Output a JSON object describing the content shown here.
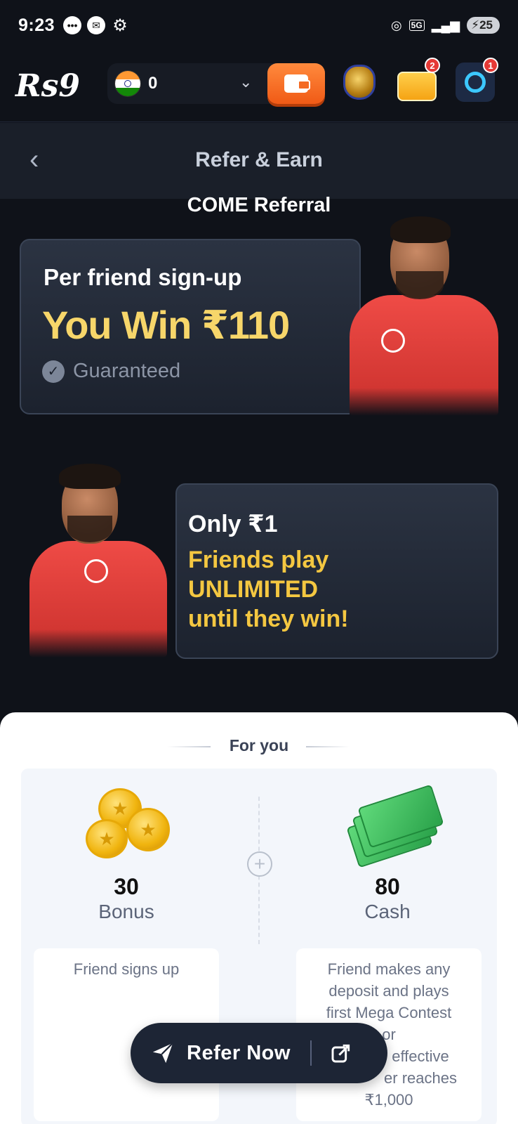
{
  "status_bar": {
    "time": "9:23",
    "network": "5G",
    "battery": "25"
  },
  "header": {
    "logo": "Rs9",
    "balance": "0",
    "jar_badge": "",
    "gift_badge": "2",
    "support_badge": "1"
  },
  "titlebar": {
    "title": "Refer & Earn"
  },
  "subtitle": "COME Referral",
  "card1": {
    "line1": "Per friend sign-up",
    "line2": "You Win ₹110",
    "line3": "Guaranteed"
  },
  "card2": {
    "only": "Only ₹1",
    "line1": "Friends play",
    "line2": "UNLIMITED",
    "line3": "until they win!"
  },
  "panel": {
    "heading": "For you",
    "bonus": {
      "amount": "30",
      "label": "Bonus",
      "desc": "Friend signs up"
    },
    "cash": {
      "amount": "80",
      "label": "Cash",
      "desc_lines": [
        "Friend makes any",
        "deposit and plays",
        "first Mega Contest",
        "or",
        "effective",
        "er reaches",
        "₹1,000"
      ]
    }
  },
  "refer": {
    "label": "Refer Now"
  },
  "colors": {
    "accent_yellow": "#f4c741",
    "background": "#0f1219",
    "button_orange": "#f46a22"
  }
}
